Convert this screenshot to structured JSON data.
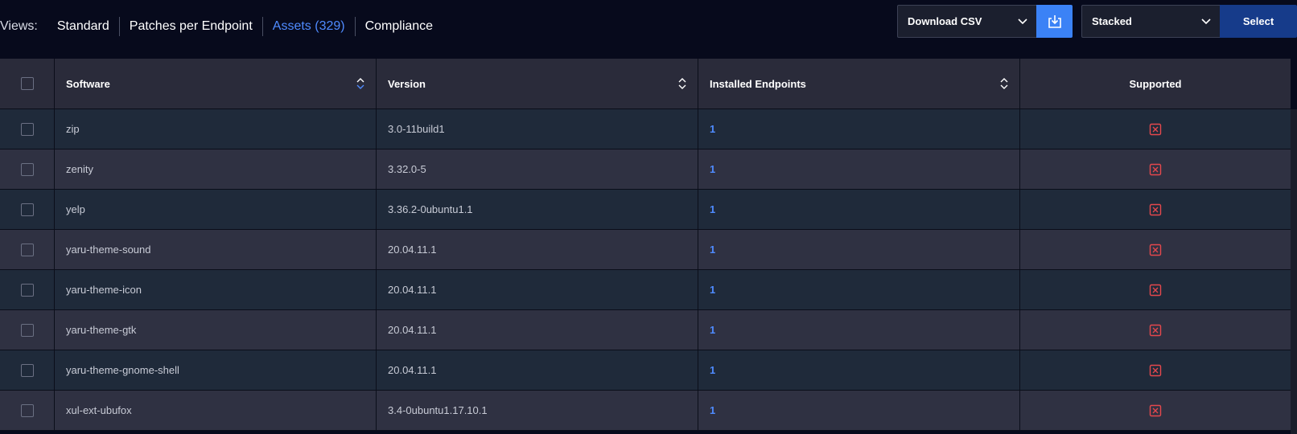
{
  "views": {
    "label": "Views:",
    "tabs": [
      {
        "label": "Standard",
        "active": false
      },
      {
        "label": "Patches per Endpoint",
        "active": false
      },
      {
        "label": "Assets (329)",
        "active": true
      },
      {
        "label": "Compliance",
        "active": false
      }
    ]
  },
  "toolbar": {
    "download_select_value": "Download CSV",
    "download_button_icon": "download-icon",
    "view_select_value": "Stacked",
    "select_button_label": "Select"
  },
  "table": {
    "columns": {
      "software": "Software",
      "version": "Version",
      "installed": "Installed Endpoints",
      "supported": "Supported"
    },
    "rows": [
      {
        "software": "zip",
        "version": "3.0-11build1",
        "installed": "1"
      },
      {
        "software": "zenity",
        "version": "3.32.0-5",
        "installed": "1"
      },
      {
        "software": "yelp",
        "version": "3.36.2-0ubuntu1.1",
        "installed": "1"
      },
      {
        "software": "yaru-theme-sound",
        "version": "20.04.11.1",
        "installed": "1"
      },
      {
        "software": "yaru-theme-icon",
        "version": "20.04.11.1",
        "installed": "1"
      },
      {
        "software": "yaru-theme-gtk",
        "version": "20.04.11.1",
        "installed": "1"
      },
      {
        "software": "yaru-theme-gnome-shell",
        "version": "20.04.11.1",
        "installed": "1"
      },
      {
        "software": "xul-ext-ubufox",
        "version": "3.4-0ubuntu1.17.10.1",
        "installed": "1"
      }
    ]
  },
  "colors": {
    "accent": "#4f8bff",
    "unsupported": "#e5484d",
    "background": "#070a1c"
  }
}
